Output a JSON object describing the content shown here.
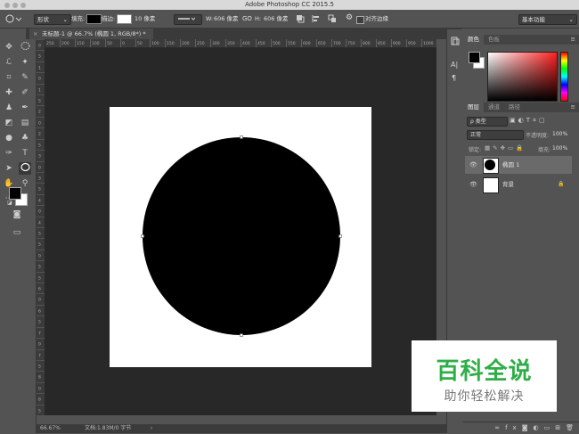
{
  "window": {
    "title": "Adobe Photoshop CC 2015.5"
  },
  "options": {
    "mode": "形状",
    "fill_label": "填充:",
    "stroke_label": "描边:",
    "stroke_width": "10 像素",
    "w_label": "W:",
    "w_value": "606 像素",
    "link_icon": "GO",
    "h_label": "H:",
    "h_value": "606 像素",
    "align_edges": "对齐边缘",
    "workspace": "基本功能"
  },
  "doc_tab": {
    "label": "未标题-1 @ 66.7% (椭圆 1, RGB/8*) *"
  },
  "ruler": {
    "top_ticks": [
      "250",
      "200",
      "150",
      "100",
      "50",
      "0",
      "50",
      "100",
      "150",
      "200",
      "250",
      "300",
      "350",
      "400",
      "450",
      "500",
      "550",
      "600",
      "650",
      "700",
      "750",
      "800",
      "850",
      "900",
      "950",
      "1000"
    ],
    "left_ticks": [
      "0",
      "5",
      "1",
      "0",
      "1",
      "5",
      "2",
      "0",
      "2",
      "5",
      "3",
      "0",
      "3",
      "5",
      "4",
      "0",
      "4",
      "5",
      "5",
      "0",
      "5",
      "5",
      "6",
      "0",
      "6",
      "5",
      "7",
      "0",
      "7",
      "5",
      "8",
      "0",
      "8",
      "5"
    ]
  },
  "status": {
    "zoom": "66.67%",
    "doc_info": "文档:1.83M/0 字节"
  },
  "panels": {
    "color_tabs": [
      "颜色",
      "色板"
    ],
    "layer_tabs": [
      "图层",
      "通道",
      "路径"
    ],
    "filter_kind": "ρ 类型",
    "blend_mode": "正常",
    "opacity_label": "不透明度:",
    "opacity_value": "100%",
    "lock_label": "锁定:",
    "fill_label": "填充:",
    "fill_value": "100%",
    "layers": [
      {
        "name": "椭圆 1"
      },
      {
        "name": "背景"
      }
    ],
    "side_icons": [
      "A|",
      "¶"
    ]
  },
  "watermark": {
    "title": "百科全说",
    "subtitle": "助你轻松解决"
  },
  "colors": {
    "fill": "#000000",
    "canvas_bg": "#282828",
    "panel_bg": "#535353",
    "accent": "#2fae48"
  }
}
